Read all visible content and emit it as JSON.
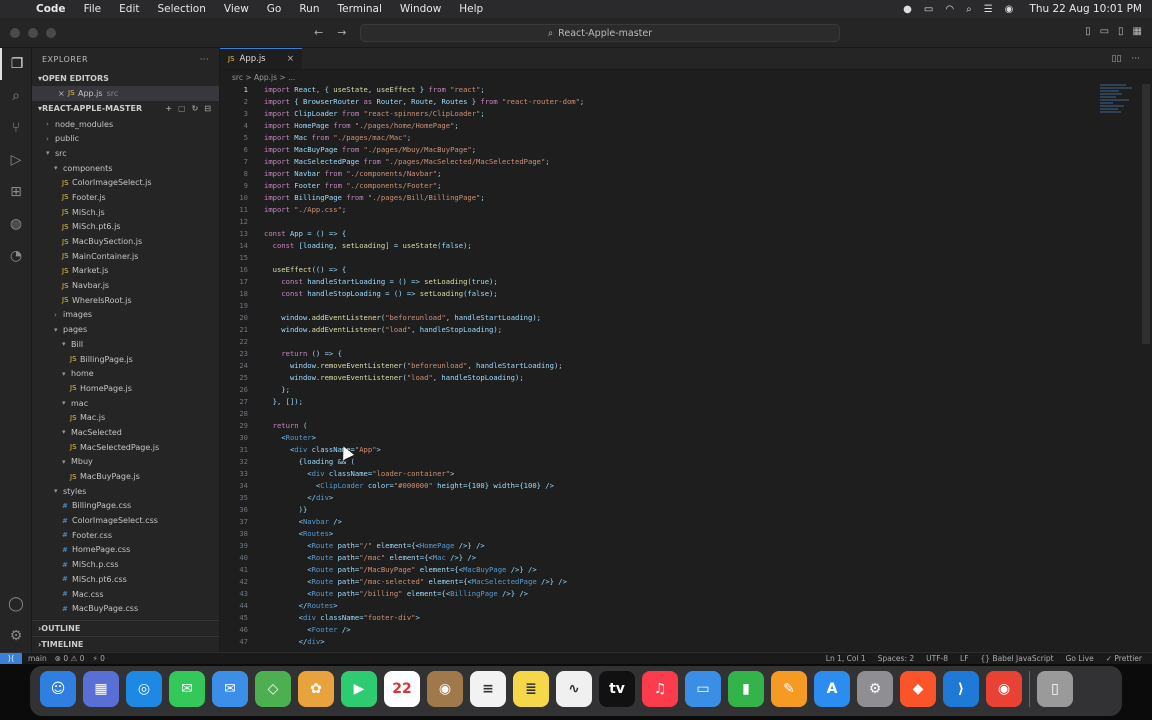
{
  "menubar": {
    "app": "Code",
    "items": [
      "File",
      "Edit",
      "Selection",
      "View",
      "Go",
      "Run",
      "Terminal",
      "Window",
      "Help"
    ],
    "clock": "Thu 22 Aug  10:01 PM"
  },
  "titlebar": {
    "search": "React-Apple-master"
  },
  "sidebar": {
    "title": "EXPLORER",
    "open_editors": "OPEN EDITORS",
    "open_file": "App.js",
    "open_file_folder": "src",
    "project": "REACT-APPLE-MASTER",
    "tree": [
      {
        "label": "node_modules",
        "depth": 1,
        "kind": "folder",
        "open": false
      },
      {
        "label": "public",
        "depth": 1,
        "kind": "folder",
        "open": false
      },
      {
        "label": "src",
        "depth": 1,
        "kind": "folder",
        "open": true
      },
      {
        "label": "components",
        "depth": 2,
        "kind": "folder",
        "open": true
      },
      {
        "label": "ColorImageSelect.js",
        "depth": 3,
        "kind": "js"
      },
      {
        "label": "Footer.js",
        "depth": 3,
        "kind": "js"
      },
      {
        "label": "MiSch.js",
        "depth": 3,
        "kind": "js"
      },
      {
        "label": "MiSch.pt6.js",
        "depth": 3,
        "kind": "js"
      },
      {
        "label": "MacBuySection.js",
        "depth": 3,
        "kind": "js"
      },
      {
        "label": "MainContainer.js",
        "depth": 3,
        "kind": "js"
      },
      {
        "label": "Market.js",
        "depth": 3,
        "kind": "js"
      },
      {
        "label": "Navbar.js",
        "depth": 3,
        "kind": "js"
      },
      {
        "label": "WhereIsRoot.js",
        "depth": 3,
        "kind": "js"
      },
      {
        "label": "images",
        "depth": 2,
        "kind": "folder",
        "open": false
      },
      {
        "label": "pages",
        "depth": 2,
        "kind": "folder",
        "open": true
      },
      {
        "label": "Bill",
        "depth": 3,
        "kind": "folder",
        "open": true
      },
      {
        "label": "BillingPage.js",
        "depth": 4,
        "kind": "js"
      },
      {
        "label": "home",
        "depth": 3,
        "kind": "folder",
        "open": true
      },
      {
        "label": "HomePage.js",
        "depth": 4,
        "kind": "js"
      },
      {
        "label": "mac",
        "depth": 3,
        "kind": "folder",
        "open": true
      },
      {
        "label": "Mac.js",
        "depth": 4,
        "kind": "js"
      },
      {
        "label": "MacSelected",
        "depth": 3,
        "kind": "folder",
        "open": true
      },
      {
        "label": "MacSelectedPage.js",
        "depth": 4,
        "kind": "js"
      },
      {
        "label": "Mbuy",
        "depth": 3,
        "kind": "folder",
        "open": true
      },
      {
        "label": "MacBuyPage.js",
        "depth": 4,
        "kind": "js"
      },
      {
        "label": "styles",
        "depth": 2,
        "kind": "folder",
        "open": true
      },
      {
        "label": "BillingPage.css",
        "depth": 3,
        "kind": "css"
      },
      {
        "label": "ColorImageSelect.css",
        "depth": 3,
        "kind": "css"
      },
      {
        "label": "Footer.css",
        "depth": 3,
        "kind": "css"
      },
      {
        "label": "HomePage.css",
        "depth": 3,
        "kind": "css"
      },
      {
        "label": "MiSch.p.css",
        "depth": 3,
        "kind": "css"
      },
      {
        "label": "MiSch.pt6.css",
        "depth": 3,
        "kind": "css"
      },
      {
        "label": "Mac.css",
        "depth": 3,
        "kind": "css"
      },
      {
        "label": "MacBuyPage.css",
        "depth": 3,
        "kind": "css"
      }
    ],
    "outline": "OUTLINE",
    "timeline": "TIMELINE"
  },
  "editor": {
    "tab": "App.js",
    "breadcrumb": "src > App.js > ...",
    "lines": [
      "import React, { useState, useEffect } from \"react\";",
      "import { BrowserRouter as Router, Route, Routes } from \"react-router-dom\";",
      "import ClipLoader from \"react-spinners/ClipLoader\";",
      "import HomePage from \"./pages/home/HomePage\";",
      "import Mac from \"./pages/mac/Mac\";",
      "import MacBuyPage from \"./pages/Mbuy/MacBuyPage\";",
      "import MacSelectedPage from \"./pages/MacSelected/MacSelectedPage\";",
      "import Navbar from \"./components/Navbar\";",
      "import Footer from \"./components/Footer\";",
      "import BillingPage from \"./pages/Bill/BillingPage\";",
      "import \"./App.css\";",
      "",
      "const App = () => {",
      "  const [loading, setLoading] = useState(false);",
      "",
      "  useEffect(() => {",
      "    const handleStartLoading = () => setLoading(true);",
      "    const handleStopLoading = () => setLoading(false);",
      "",
      "    window.addEventListener(\"beforeunload\", handleStartLoading);",
      "    window.addEventListener(\"load\", handleStopLoading);",
      "",
      "    return () => {",
      "      window.removeEventListener(\"beforeunload\", handleStartLoading);",
      "      window.removeEventListener(\"load\", handleStopLoading);",
      "    };",
      "  }, []);",
      "",
      "  return (",
      "    <Router>",
      "      <div className=\"App\">",
      "        {loading && (",
      "          <div className=\"loader-container\">",
      "            <ClipLoader color=\"#000000\" height={100} width={100} />",
      "          </div>",
      "        )}",
      "        <Navbar />",
      "        <Routes>",
      "          <Route path=\"/\" element={<HomePage />} />",
      "          <Route path=\"/mac\" element={<Mac />} />",
      "          <Route path=\"/MacBuyPage\" element={<MacBuyPage />} />",
      "          <Route path=\"/mac-selected\" element={<MacSelectedPage />} />",
      "          <Route path=\"/billing\" element={<BillingPage />} />",
      "        </Routes>",
      "        <div className=\"footer-div\">",
      "          <Footer />",
      "        </div>"
    ]
  },
  "status": {
    "left": [
      "main",
      "⊗ 0 ⚠ 0",
      "⚡ 0"
    ],
    "right": [
      "Ln 1, Col 1",
      "Spaces: 2",
      "UTF-8",
      "LF",
      "{} Babel JavaScript",
      "Go Live",
      "✓ Prettier"
    ]
  },
  "dock": {
    "calendar_day": "22",
    "items": [
      {
        "name": "finder",
        "color": "#2f7fe0",
        "glyph": "☺"
      },
      {
        "name": "launchpad",
        "color": "#5a6fd6",
        "glyph": "▦"
      },
      {
        "name": "safari",
        "color": "#1e88e5",
        "glyph": "◎"
      },
      {
        "name": "messages",
        "color": "#34c759",
        "glyph": "✉"
      },
      {
        "name": "mail",
        "color": "#3b8fe8",
        "glyph": "✉"
      },
      {
        "name": "maps",
        "color": "#4caf50",
        "glyph": "◇"
      },
      {
        "name": "photos",
        "color": "#e9a33c",
        "glyph": "✿"
      },
      {
        "name": "facetime",
        "color": "#2ecc71",
        "glyph": "▶"
      },
      {
        "name": "calendar",
        "color": "#ffffff",
        "glyph": "22"
      },
      {
        "name": "contacts",
        "color": "#a0794a",
        "glyph": "◉"
      },
      {
        "name": "reminders",
        "color": "#f2f2f2",
        "glyph": "≡"
      },
      {
        "name": "notes",
        "color": "#f5d84a",
        "glyph": "≣"
      },
      {
        "name": "freeform",
        "color": "#f0f0f0",
        "glyph": "∿"
      },
      {
        "name": "apple-tv",
        "color": "#111111",
        "glyph": "tv"
      },
      {
        "name": "music",
        "color": "#fa3c4c",
        "glyph": "♫"
      },
      {
        "name": "keynote",
        "color": "#3a8ee6",
        "glyph": "▭"
      },
      {
        "name": "numbers",
        "color": "#34b34a",
        "glyph": "▮"
      },
      {
        "name": "pages",
        "color": "#f59b23",
        "glyph": "✎"
      },
      {
        "name": "app-store",
        "color": "#2d8cf0",
        "glyph": "A"
      },
      {
        "name": "system-settings",
        "color": "#8e8e93",
        "glyph": "⚙"
      },
      {
        "name": "brave",
        "color": "#fb542b",
        "glyph": "◆"
      },
      {
        "name": "vscode",
        "color": "#1e7ad6",
        "glyph": "⟩"
      },
      {
        "name": "chrome",
        "color": "#e94235",
        "glyph": "◉"
      },
      {
        "name": "trash",
        "color": "#9a9a9a",
        "glyph": "▯"
      }
    ]
  }
}
